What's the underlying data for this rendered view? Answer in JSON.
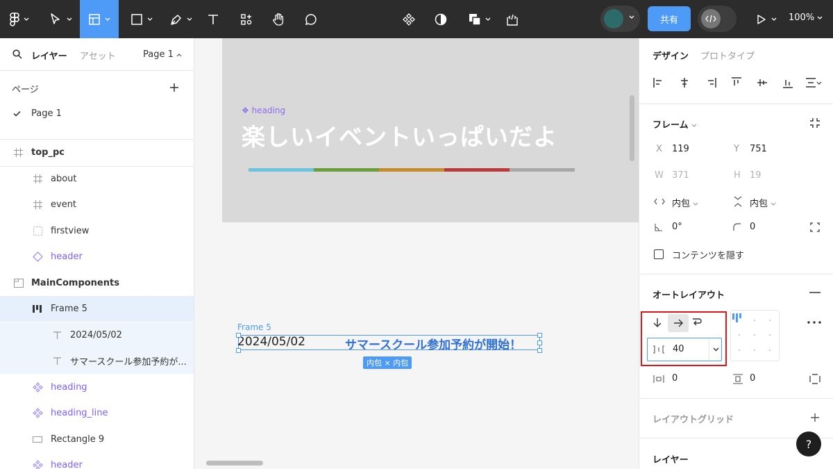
{
  "toolbar": {
    "share_label": "共有",
    "zoom": "100%"
  },
  "left_panel": {
    "tab_layers": "レイヤー",
    "tab_assets": "アセット",
    "page_selector": "Page 1",
    "pages_title": "ページ",
    "current_page": "Page 1",
    "layers": [
      {
        "label": "top_pc",
        "icon": "frame-icon"
      },
      {
        "label": "about",
        "icon": "frame-icon"
      },
      {
        "label": "event",
        "icon": "frame-icon"
      },
      {
        "label": "firstview",
        "icon": "section-dashed-icon"
      },
      {
        "label": "header",
        "icon": "instance-icon"
      },
      {
        "label": "MainComponents",
        "icon": "section-icon"
      },
      {
        "label": "Frame 5",
        "icon": "autolayout-icon"
      },
      {
        "label": "2024/05/02",
        "icon": "text-icon"
      },
      {
        "label": "サマースクール参加予約が...",
        "icon": "text-icon"
      },
      {
        "label": "heading",
        "icon": "component-icon"
      },
      {
        "label": "heading_line",
        "icon": "component-icon"
      },
      {
        "label": "Rectangle 9",
        "icon": "rectangle-icon"
      },
      {
        "label": "header",
        "icon": "component-icon"
      }
    ]
  },
  "canvas": {
    "heading_label": "heading",
    "heading_text": "楽しいイベントいっぱいだよ",
    "heading_line_colors": [
      "#6cc4dc",
      "#6a9e3a",
      "#c88c2c",
      "#b83a3a",
      "#a8a8a8"
    ],
    "frame5_label": "Frame 5",
    "frame5_date": "2024/05/02",
    "frame5_title": "サマースクール参加予約が開始！",
    "size_badge": "内包 × 内包"
  },
  "right_panel": {
    "tab_design": "デザイン",
    "tab_prototype": "プロトタイプ",
    "frame_section": "フレーム",
    "x_label": "X",
    "x_value": "119",
    "y_label": "Y",
    "y_value": "751",
    "w_label": "W",
    "w_value": "371",
    "h_label": "H",
    "h_value": "19",
    "width_mode": "内包",
    "height_mode": "内包",
    "rotation": "0°",
    "corner_radius": "0",
    "clip_content": "コンテンツを隠す",
    "autolayout_section": "オートレイアウト",
    "gap_value": "40",
    "padding_h": "0",
    "padding_v": "0",
    "layout_grid_section": "レイアウトグリッド",
    "layer_section": "レイヤー",
    "help": "?"
  },
  "colors": {
    "accent": "#4d9bf7",
    "component_purple": "#7b61ff",
    "highlight_red": "#e8141a",
    "toolbar_bg": "#2c2c2c"
  }
}
